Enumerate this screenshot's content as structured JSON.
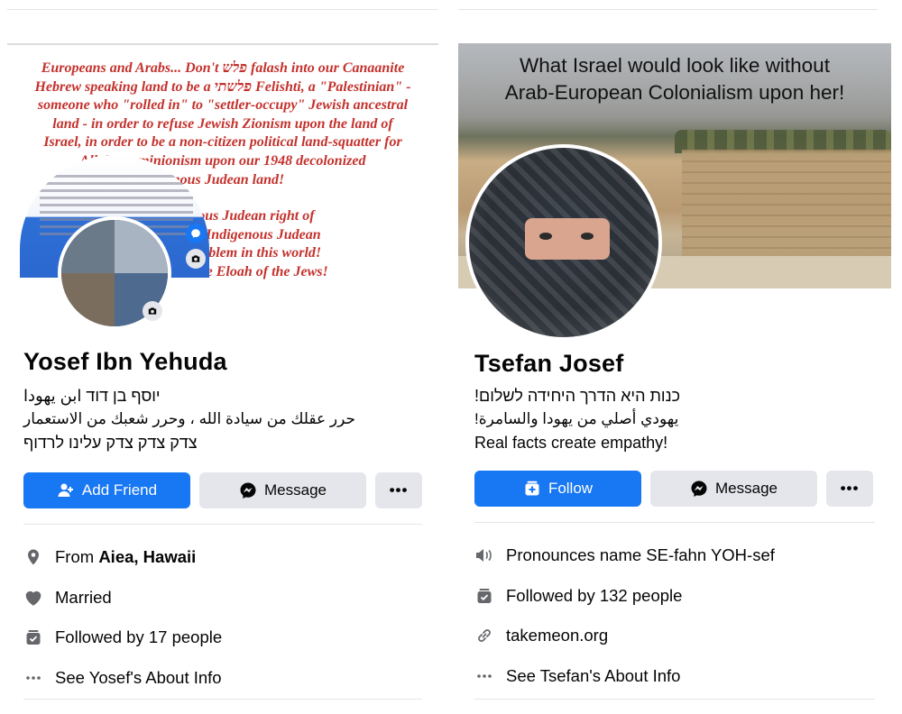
{
  "left_profile": {
    "cover": {
      "lines": [
        "Europeans and Arabs... Don't פלש falash into our Canaanite",
        "Hebrew speaking land to be a פלשתי Felishti, a \"Palestinian\" -",
        "someone who \"rolled in\" to \"settler-occupy\" Jewish ancestral",
        "land - in order to refuse Jewish Zionism upon the land of",
        "Israel, in order to be a non-citizen political land-squatter for",
        "Allah... ...minionism upon our 1948 decolonized",
        "...nous Judean land!",
        "",
        "...s Indigenous Judean right of",
        "...lecolonized Indigenous Judean",
        "...tisemitic problem in this world!",
        "...to YHWH, the Eloah of the Jews!"
      ]
    },
    "name": "Yosef Ibn Yehuda",
    "bio": [
      "יוסף בן דוד ابن يهودا",
      "حرر عقلك من سيادة الله ، وحرر شعبك من الاستعمار",
      "צדק צדק צדק עלינו לרדוף"
    ],
    "buttons": {
      "primary": "Add Friend",
      "message": "Message",
      "more": "•••"
    },
    "info": {
      "from_prefix": "From ",
      "from_place": "Aiea, Hawaii",
      "relationship": "Married",
      "followers": "Followed by 17 people",
      "about": "See Yosef's About Info"
    }
  },
  "right_profile": {
    "cover": {
      "title_lines": [
        "What Israel would look like without",
        "Arab-European Colonialism upon her!"
      ]
    },
    "name": "Tsefan Josef",
    "bio": [
      "כנות היא הדרך היחידה לשלום!",
      "يهودي أصلي من يهودا والسامرة!",
      "Real facts create empathy!"
    ],
    "buttons": {
      "primary": "Follow",
      "message": "Message",
      "more": "•••"
    },
    "info": {
      "pronounce": "Pronounces name SE-fahn YOH-sef",
      "followers": "Followed by 132 people",
      "website": "takemeon.org",
      "about": "See Tsefan's About Info"
    }
  },
  "colors": {
    "primary_blue": "#1877f2",
    "secondary_gray": "#e4e6eb",
    "icon_gray": "#65676b",
    "cover_red": "#c3322d"
  },
  "icons": [
    "add-friend-icon",
    "messenger-icon",
    "follow-icon",
    "location-pin-icon",
    "heart-icon",
    "followers-icon",
    "sound-icon",
    "link-icon",
    "more-dots-icon",
    "camera-icon"
  ]
}
